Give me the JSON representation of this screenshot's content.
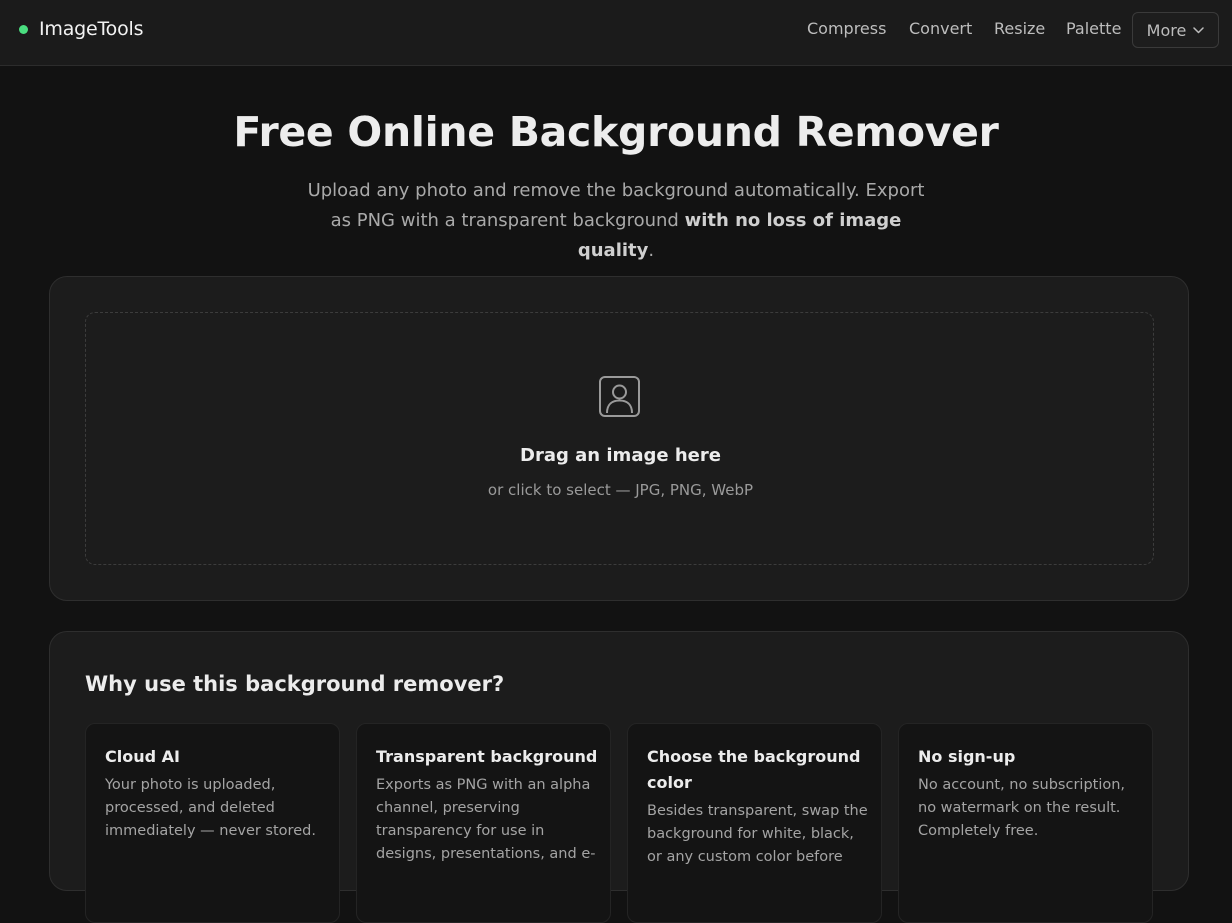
{
  "header": {
    "brand": "ImageTools",
    "nav": [
      "Compress",
      "Convert",
      "Resize",
      "Palette"
    ],
    "more_label": "More",
    "brand_color": "#4ade80"
  },
  "hero": {
    "title": "Free Online Background Remover",
    "subtitle_plain": "Upload any photo and remove the background automatically. Export as PNG with a transparent background ",
    "subtitle_bold": "with no loss of image quality",
    "subtitle_end": "."
  },
  "upload": {
    "icon": "portrait-icon",
    "title": "Drag an image here",
    "subtitle": "or click to select — JPG, PNG, WebP"
  },
  "why": {
    "title": "Why use this background remover?",
    "features": [
      {
        "title": "Cloud AI",
        "description": "Your photo is uploaded, processed, and deleted immediately — never stored."
      },
      {
        "title": "Transparent background",
        "description": "Exports as PNG with an alpha channel, preserving transparency for use in designs, presentations, and e-"
      },
      {
        "title": "Choose the background color",
        "description": "Besides transparent, swap the background for white, black, or any custom color before"
      },
      {
        "title": "No sign-up",
        "description": "No account, no subscription, no watermark on the result. Completely free."
      }
    ]
  }
}
